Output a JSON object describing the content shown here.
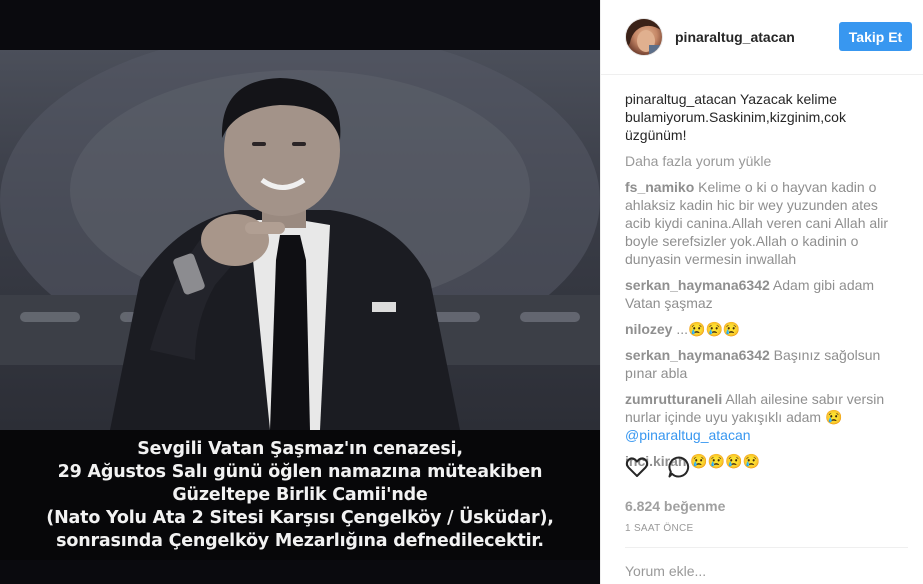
{
  "post": {
    "image_text": [
      "Sevgili Vatan Şaşmaz'ın cenazesi,",
      "29 Ağustos Salı günü öğlen namazına müteakiben",
      "Güzeltepe Birlik Camii'nde",
      "(Nato Yolu Ata 2 Sitesi Karşısı Çengelköy / Üsküdar),",
      "sonrasında Çengelköy Mezarlığına defnedilecektir."
    ]
  },
  "header": {
    "username": "pinaraltug_atacan",
    "follow_label": "Takip Et"
  },
  "caption": {
    "username": "pinaraltug_atacan",
    "text": "Yazacak kelime bulamiyorum.Saskinim,kizginim,cok üzgünüm!"
  },
  "load_more_label": "Daha fazla yorum yükle",
  "comments": [
    {
      "user": "fs_namiko",
      "text": "Kelime o ki o hayvan kadin o ahlaksiz kadin hic bir wey yuzunden ates acib kiydi canina.Allah veren cani Allah alir boyle serefsizler yok.Allah o kadinin o dunyasin vermesin inwallah"
    },
    {
      "user": "serkan_haymana6342",
      "text": "Adam gibi adam Vatan şaşmaz"
    },
    {
      "user": "nilozey",
      "text": "...😢😢😢"
    },
    {
      "user": "serkan_haymana6342",
      "text": "Başınız sağolsun pınar abla"
    },
    {
      "user": "zumrutturaneli",
      "text": "Allah ailesine sabır versin nurlar içinde uyu yakışıklı adam 😢",
      "mention": "@pinaraltug_atacan"
    },
    {
      "user": "inci.kiran",
      "text": "😢😢😢😢"
    }
  ],
  "likes": "6.824 beğenme",
  "time": "1 SAAT ÖNCE",
  "add_comment_placeholder": "Yorum ekle...",
  "colors": {
    "accent": "#3897f0",
    "text": "#262626",
    "muted": "#999999"
  },
  "icons": {
    "like": "heart-icon",
    "comment": "comment-bubble-icon"
  }
}
